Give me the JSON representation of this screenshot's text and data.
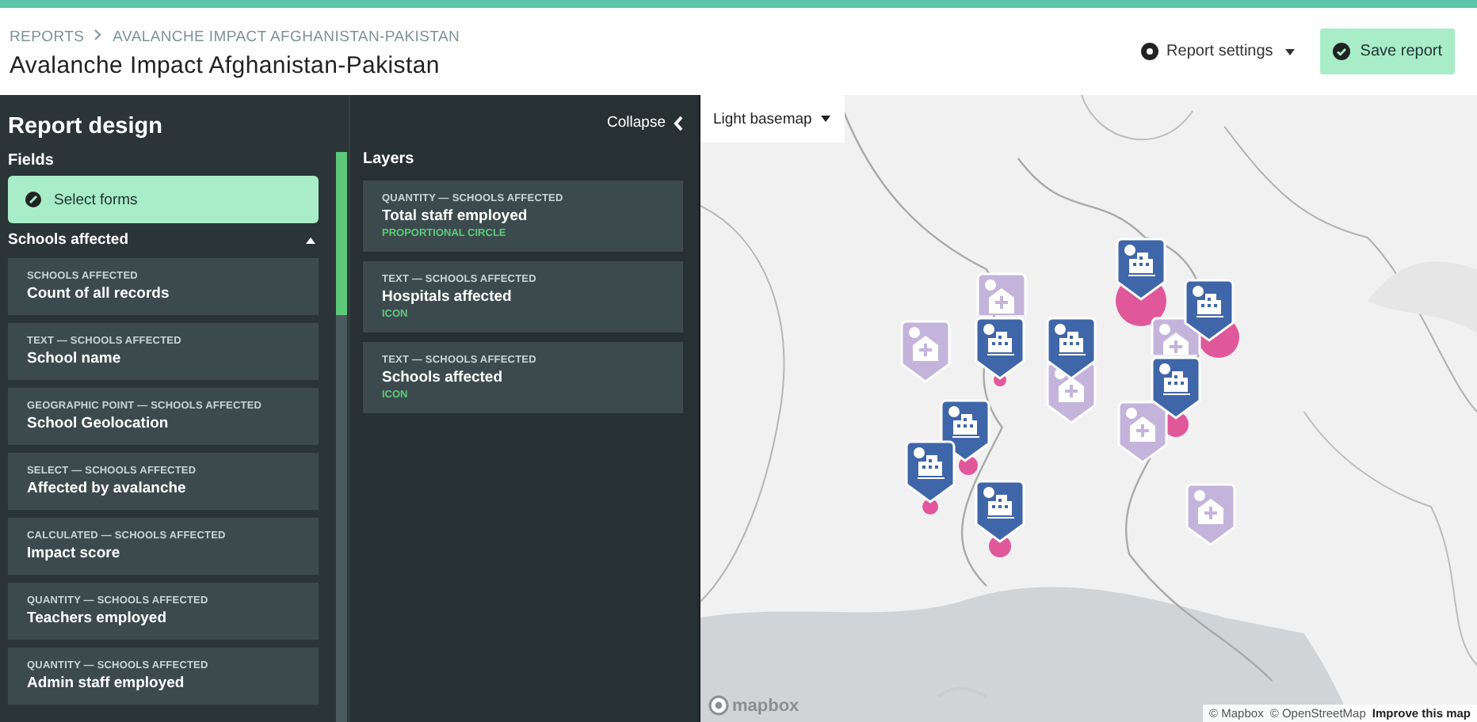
{
  "header": {
    "breadcrumb": [
      "REPORTS",
      "AVALANCHE IMPACT AFGHANISTAN-PAKISTAN"
    ],
    "title": "Avalanche Impact Afghanistan-Pakistan",
    "settings_label": "Report settings",
    "save_label": "Save report"
  },
  "report_design": {
    "title": "Report design",
    "fields_label": "Fields",
    "select_forms": "Select forms",
    "sections": [
      {
        "title": "Schools affected",
        "expanded": true,
        "items": [
          {
            "meta": "SCHOOLS AFFECTED",
            "name": "Count of all records"
          },
          {
            "meta": "TEXT — SCHOOLS AFFECTED",
            "name": "School name"
          },
          {
            "meta": "GEOGRAPHIC POINT — SCHOOLS AFFECTED",
            "name": "School Geolocation"
          },
          {
            "meta": "SELECT — SCHOOLS AFFECTED",
            "name": "Affected by avalanche"
          },
          {
            "meta": "CALCULATED — SCHOOLS AFFECTED",
            "name": "Impact score"
          },
          {
            "meta": "QUANTITY — SCHOOLS AFFECTED",
            "name": "Teachers employed"
          },
          {
            "meta": "QUANTITY — SCHOOLS AFFECTED",
            "name": "Admin staff employed"
          }
        ]
      }
    ]
  },
  "layers": {
    "collapse_label": "Collapse",
    "title": "Layers",
    "items": [
      {
        "meta": "QUANTITY — SCHOOLS AFFECTED",
        "name": "Total staff employed",
        "type": "PROPORTIONAL CIRCLE"
      },
      {
        "meta": "TEXT — SCHOOLS AFFECTED",
        "name": "Hospitals affected",
        "type": "ICON"
      },
      {
        "meta": "TEXT — SCHOOLS AFFECTED",
        "name": "Schools affected",
        "type": "ICON"
      }
    ]
  },
  "map": {
    "basemap_label": "Light basemap",
    "logo_text": "mapbox",
    "attribution": [
      "© Mapbox",
      "© OpenStreetMap"
    ],
    "improve_link": "Improve this map",
    "markers": [
      {
        "kind": "circle"
      },
      {
        "kind": "circle"
      },
      {
        "kind": "circle"
      },
      {
        "kind": "circle"
      },
      {
        "kind": "circle"
      },
      {
        "kind": "circle"
      },
      {
        "kind": "circle"
      },
      {
        "kind": "hospital"
      },
      {
        "kind": "hospital"
      },
      {
        "kind": "hospital"
      },
      {
        "kind": "hospital"
      },
      {
        "kind": "hospital"
      },
      {
        "kind": "hospital"
      },
      {
        "kind": "school"
      },
      {
        "kind": "school"
      },
      {
        "kind": "school"
      },
      {
        "kind": "school"
      },
      {
        "kind": "school"
      },
      {
        "kind": "school"
      },
      {
        "kind": "school"
      },
      {
        "kind": "school"
      }
    ]
  }
}
